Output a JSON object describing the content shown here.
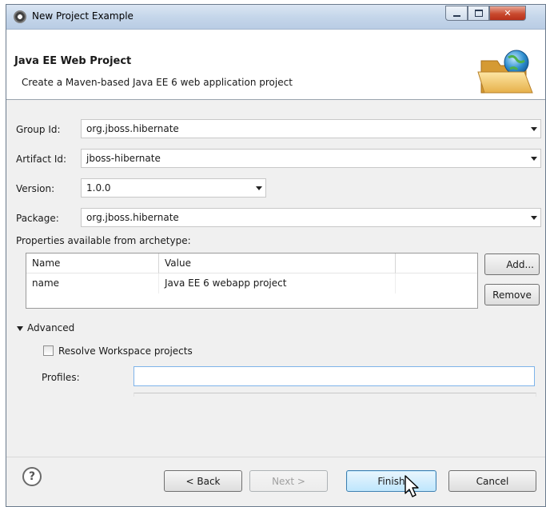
{
  "window": {
    "title": "New Project Example"
  },
  "banner": {
    "title": "Java EE Web Project",
    "description": "Create a Maven-based Java EE 6 web application project"
  },
  "form": {
    "group_id": {
      "label": "Group Id:",
      "value": "org.jboss.hibernate"
    },
    "artifact_id": {
      "label": "Artifact Id:",
      "value": "jboss-hibernate"
    },
    "version": {
      "label": "Version:",
      "value": "1.0.0"
    },
    "package": {
      "label": "Package:",
      "value": "org.jboss.hibernate"
    }
  },
  "properties": {
    "label": "Properties available from archetype:",
    "columns": [
      "Name",
      "Value",
      ""
    ],
    "rows": [
      {
        "name": "name",
        "value": "Java EE 6 webapp project"
      }
    ],
    "add_label": "Add...",
    "remove_label": "Remove"
  },
  "advanced": {
    "label": "Advanced",
    "resolve_workspace_label": "Resolve Workspace projects",
    "resolve_workspace_checked": false,
    "profiles_label": "Profiles:",
    "profiles_value": ""
  },
  "footer": {
    "back_label": "< Back",
    "next_label": "Next >",
    "finish_label": "Finish",
    "cancel_label": "Cancel"
  },
  "icons": {
    "app": "eclipse-icon",
    "banner": "folder-globe-icon",
    "help": "help-icon"
  },
  "colors": {
    "accent": "#3c7fb1",
    "title_bar": "#c5d6ea",
    "close_button": "#c94a2e"
  }
}
